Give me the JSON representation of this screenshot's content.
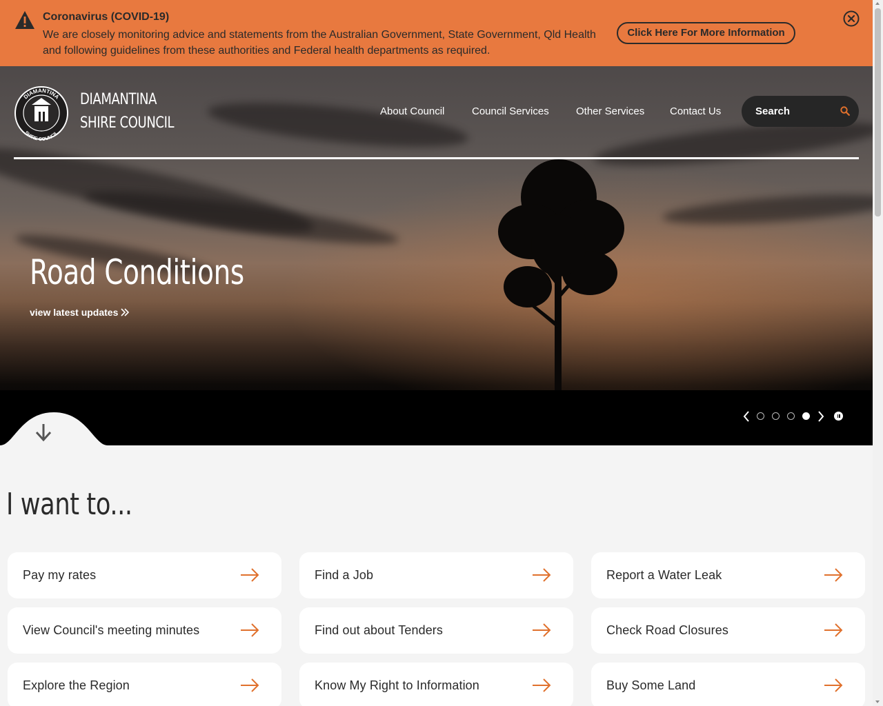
{
  "alert": {
    "title": "Coronavirus (COVID-19)",
    "text": "We are closely monitoring advice and statements from the Australian Government, State Government, Qld Health and following guidelines from these authorities and Federal health departments as required.",
    "button_label": "Click Here For More Information",
    "background_color": "#e8793f",
    "icons": {
      "warning": "warning-icon",
      "close": "close-icon"
    }
  },
  "header": {
    "site_name_line1": "DIAMANTINA",
    "site_name_line2": "SHIRE COUNCIL",
    "logo_text": {
      "top": "DIAMANTINA",
      "bottom": "SHIRE COUNCIL"
    },
    "nav": [
      {
        "label": "About Council"
      },
      {
        "label": "Council Services"
      },
      {
        "label": "Other Services"
      },
      {
        "label": "Contact Us"
      }
    ],
    "search": {
      "placeholder": "Search",
      "icon": "search-icon"
    }
  },
  "hero": {
    "title": "Road Conditions",
    "link_label": "view latest updates",
    "slider": {
      "slide_count": 4,
      "active_slide": 4
    }
  },
  "want_to": {
    "title": "I want to...",
    "accent_color": "#e0702c",
    "items": [
      {
        "label": "Pay my rates"
      },
      {
        "label": "Find a Job"
      },
      {
        "label": "Report a Water Leak"
      },
      {
        "label": "View Council's meeting minutes"
      },
      {
        "label": "Find out about Tenders"
      },
      {
        "label": "Check Road Closures"
      },
      {
        "label": "Explore the Region"
      },
      {
        "label": "Know My Right to Information"
      },
      {
        "label": "Buy Some Land"
      }
    ]
  }
}
